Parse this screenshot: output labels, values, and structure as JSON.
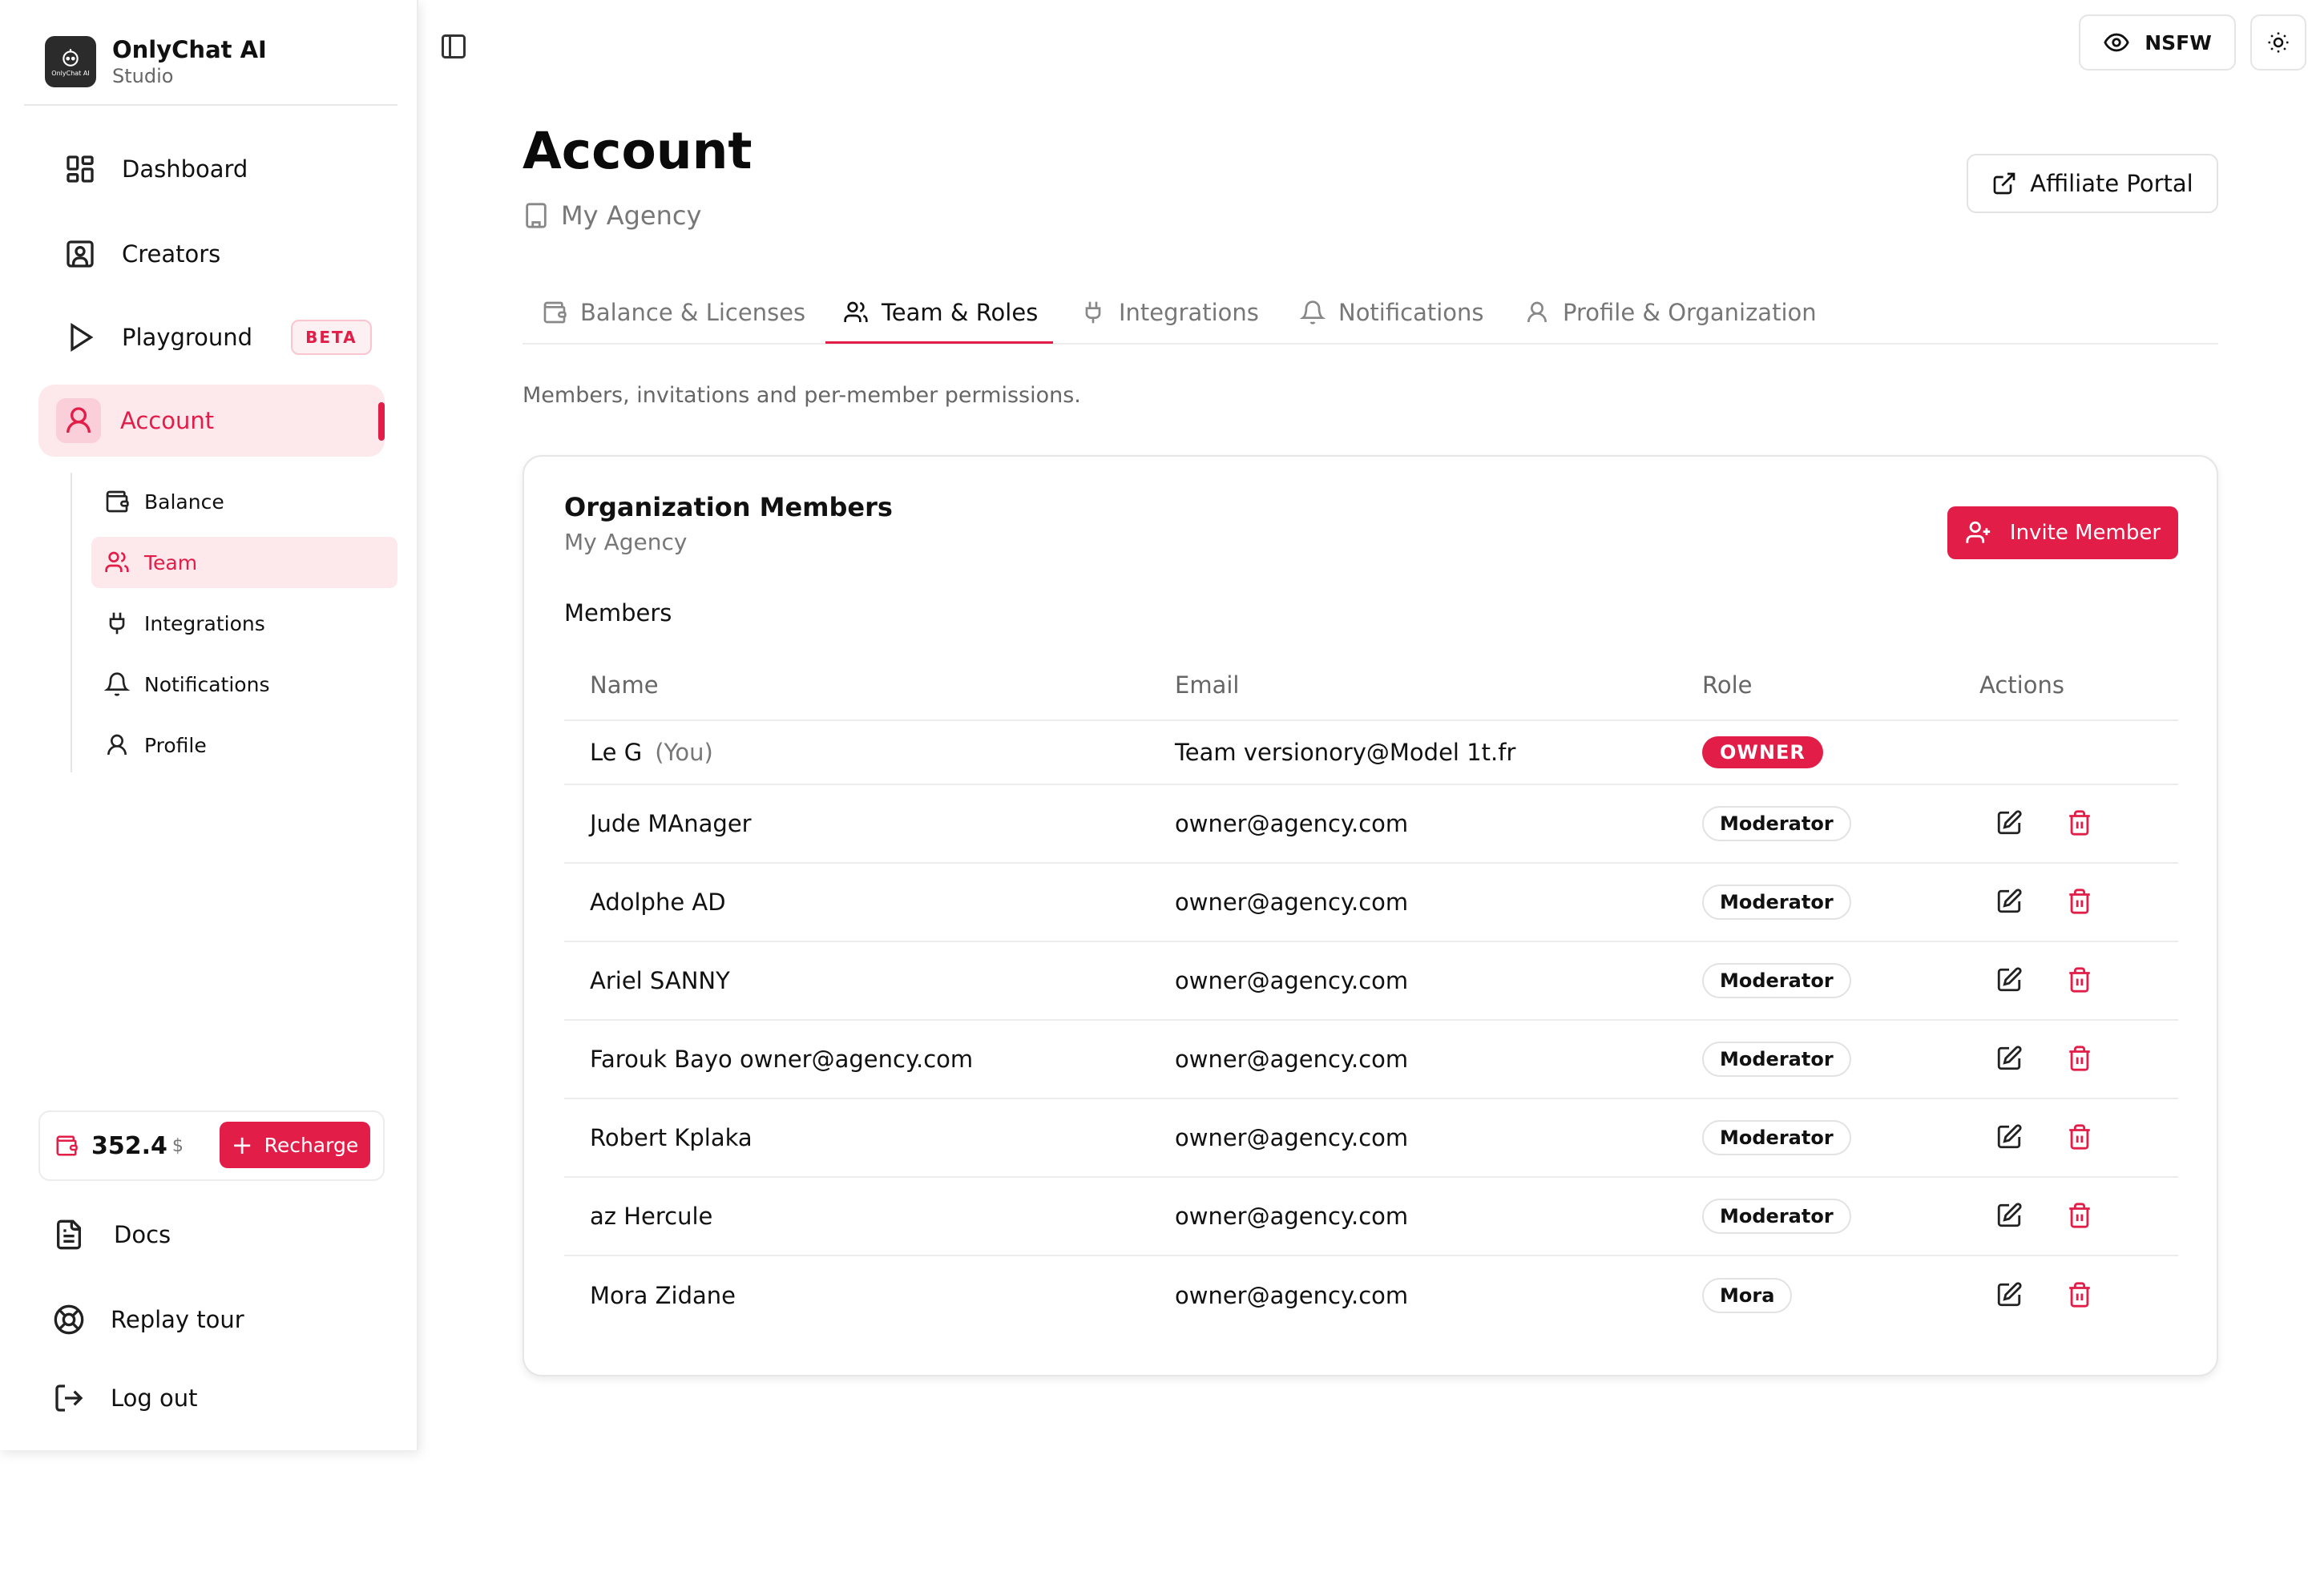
{
  "brand": {
    "name": "OnlyChat AI",
    "sub": "Studio",
    "logo_text": "OnlyChat AI"
  },
  "nav": {
    "dashboard": "Dashboard",
    "creators": "Creators",
    "playground": "Playground",
    "beta": "BETA",
    "account": "Account"
  },
  "subnav": {
    "balance": "Balance",
    "team": "Team",
    "integrations": "Integrations",
    "notifications": "Notifications",
    "profile": "Profile"
  },
  "wallet": {
    "amount": "352.4",
    "currency": "$",
    "recharge": "Recharge"
  },
  "bottom": {
    "docs": "Docs",
    "replay": "Replay tour",
    "logout": "Log out"
  },
  "topbar": {
    "nsfw": "NSFW"
  },
  "header": {
    "title": "Account",
    "org": "My Agency",
    "affiliate": "Affiliate Portal"
  },
  "tabs": {
    "balance": "Balance & Licenses",
    "team": "Team & Roles",
    "integrations": "Integrations",
    "notifications": "Notifications",
    "profile": "Profile & Organization"
  },
  "section": {
    "description": "Members, invitations and per-member permissions."
  },
  "card": {
    "title": "Organization Members",
    "org": "My Agency",
    "invite": "Invite Member",
    "members_label": "Members"
  },
  "table": {
    "headers": {
      "name": "Name",
      "email": "Email",
      "role": "Role",
      "actions": "Actions"
    },
    "rows": [
      {
        "name": "Le G",
        "you": "(You)",
        "email": "Team versionory@Model 1t.fr",
        "role": "OWNER"
      },
      {
        "name": "Jude MAnager",
        "email": "owner@agency.com",
        "role": "Moderator"
      },
      {
        "name": "Adolphe AD",
        "email": "owner@agency.com",
        "role": "Moderator"
      },
      {
        "name": "Ariel SANNY",
        "email": "owner@agency.com",
        "role": "Moderator"
      },
      {
        "name": "Farouk Bayo owner@agency.com",
        "email": "owner@agency.com",
        "role": "Moderator"
      },
      {
        "name": "Robert Kplaka",
        "email": "owner@agency.com",
        "role": "Moderator"
      },
      {
        "name": "az Hercule",
        "email": "owner@agency.com",
        "role": "Moderator"
      },
      {
        "name": "Mora Zidane",
        "email": "owner@agency.com",
        "role": "Mora"
      }
    ]
  },
  "colors": {
    "accent": "#e11d48",
    "accent_soft": "#fde8ec",
    "border": "#ececec"
  },
  "icons": {
    "dashboard": "grid-icon",
    "creators": "user-square-icon",
    "playground": "play-icon",
    "account": "user-icon",
    "docs": "file-text-icon",
    "replay": "life-buoy-icon",
    "logout": "log-out-icon"
  }
}
